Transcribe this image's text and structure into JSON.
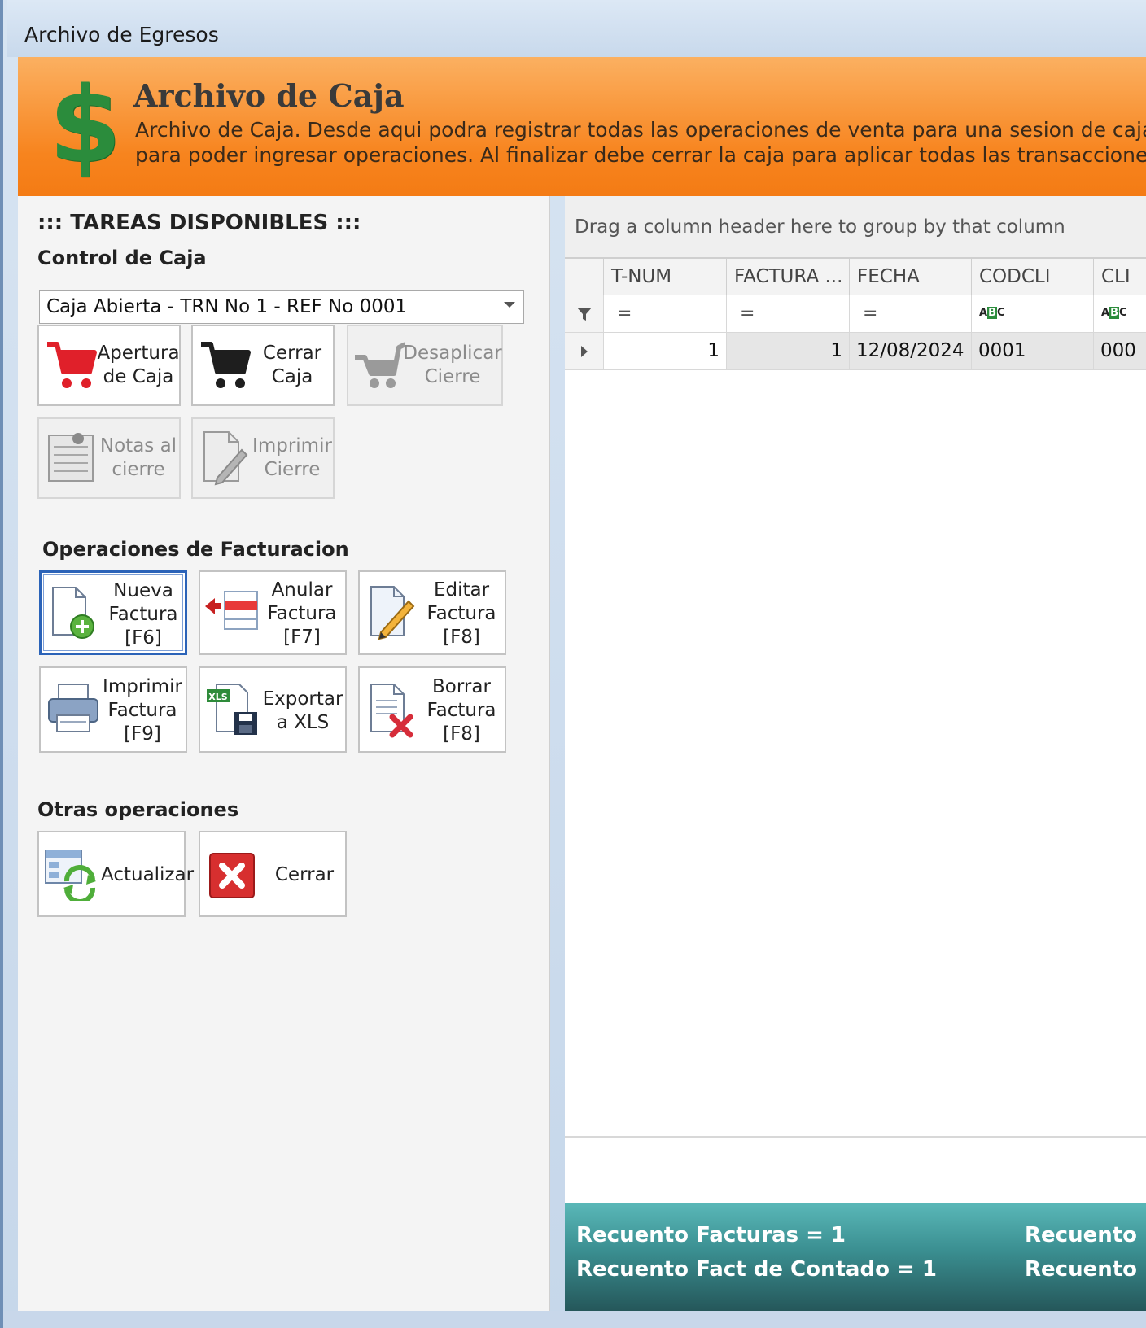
{
  "window": {
    "title": "Archivo de Egresos"
  },
  "banner": {
    "icon": "dollar-icon",
    "symbol": "$",
    "title": "Archivo de Caja",
    "description_line1": "Archivo de Caja. Desde aqui podra registrar todas las operaciones de venta para una sesion de caja abierta",
    "description_line2": "para poder ingresar operaciones. Al finalizar debe cerrar la caja para aplicar todas las transacciones registrad"
  },
  "tasks": {
    "heading": "::: TAREAS DISPONIBLES :::",
    "control_caja": {
      "title": "Control de Caja",
      "combo_value": "Caja Abierta - TRN No 1 - REF No 0001",
      "buttons": [
        {
          "label": "Apertura\nde Caja",
          "icon": "cart-red-icon",
          "enabled": true
        },
        {
          "label": "Cerrar\nCaja",
          "icon": "cart-black-icon",
          "enabled": true
        },
        {
          "label": "Desaplicar\nCierre",
          "icon": "cart-gray-icon",
          "enabled": false
        },
        {
          "label": "Notas al\ncierre",
          "icon": "notepad-icon",
          "enabled": false
        },
        {
          "label": "Imprimir\nCierre",
          "icon": "document-edit-icon",
          "enabled": false
        }
      ]
    },
    "facturacion": {
      "title": "Operaciones de Facturacion",
      "buttons": [
        {
          "label": "Nueva\nFactura\n[F6]",
          "icon": "new-document-icon"
        },
        {
          "label": "Anular\nFactura\n[F7]",
          "icon": "delete-row-icon"
        },
        {
          "label": "Editar\nFactura\n[F8]",
          "icon": "edit-document-icon"
        },
        {
          "label": "Imprimir\nFactura\n[F9]",
          "icon": "printer-icon"
        },
        {
          "label": "Exportar\na XLS",
          "icon": "export-xls-icon"
        },
        {
          "label": "Borrar\nFactura\n[F8]",
          "icon": "delete-document-icon"
        }
      ]
    },
    "otras": {
      "title": "Otras operaciones",
      "buttons": [
        {
          "label": "Actualizar",
          "icon": "refresh-icon"
        },
        {
          "label": "Cerrar",
          "icon": "close-icon"
        }
      ]
    }
  },
  "grid": {
    "group_panel_text": "Drag a column header here to group by that column",
    "columns": [
      "T-NUM",
      "FACTURA ...",
      "FECHA",
      "CODCLI",
      "CLI"
    ],
    "filter_symbols": [
      "=",
      "=",
      "=",
      "ABC",
      "ABC"
    ],
    "rows": [
      {
        "tnum": "1",
        "factura": "1",
        "fecha": "12/08/2024",
        "codcli": "0001",
        "cli": "000"
      }
    ]
  },
  "summary": {
    "recuento_facturas": "Recuento Facturas = 1",
    "recuento_contado": "Recuento Fact de Contado = 1",
    "recuento_right1": "Recuento Fa",
    "recuento_right2": "Recuento Fa"
  },
  "colors": {
    "banner_orange": "#f7841e",
    "dollar_green": "#2b8c3c",
    "summary_teal": "#3a8e90",
    "focus_blue": "#2b63b8"
  }
}
